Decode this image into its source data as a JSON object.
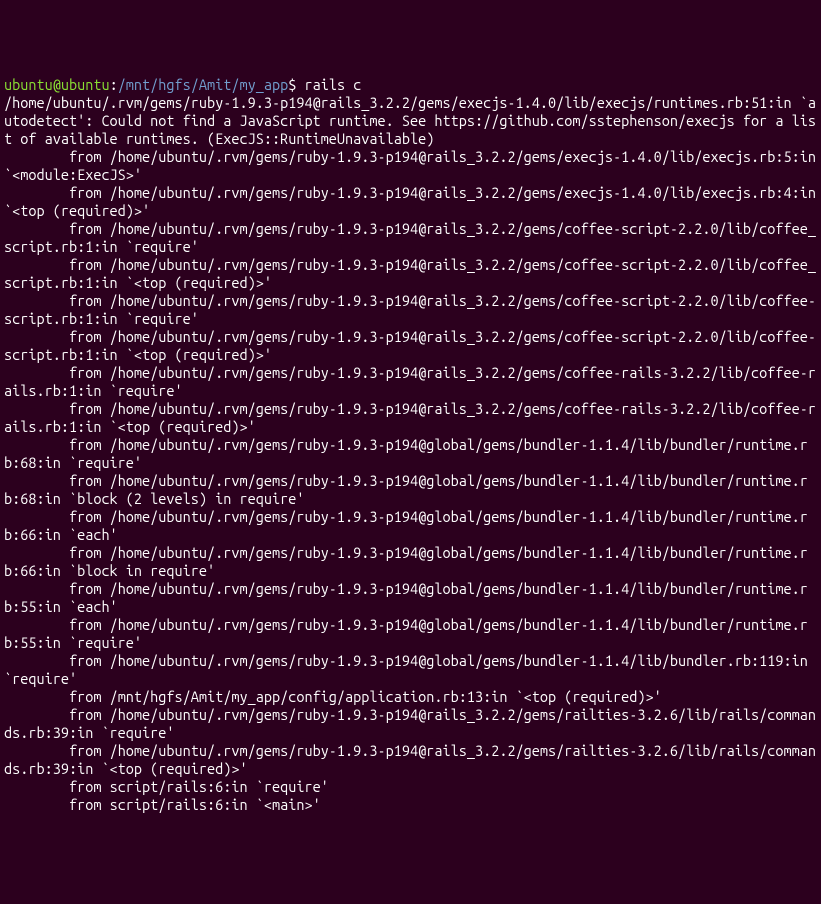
{
  "prompt": {
    "user_host": "ubuntu@ubuntu",
    "separator": ":",
    "path": "/mnt/hgfs/Amit/my_app",
    "symbol": "$",
    "command": "rails c"
  },
  "lines": [
    "/home/ubuntu/.rvm/gems/ruby-1.9.3-p194@rails_3.2.2/gems/execjs-1.4.0/lib/execjs/runtimes.rb:51:in `autodetect': Could not find a JavaScript runtime. See https://github.com/sstephenson/execjs for a list of available runtimes. (ExecJS::RuntimeUnavailable)",
    "        from /home/ubuntu/.rvm/gems/ruby-1.9.3-p194@rails_3.2.2/gems/execjs-1.4.0/lib/execjs.rb:5:in `<module:ExecJS>'",
    "        from /home/ubuntu/.rvm/gems/ruby-1.9.3-p194@rails_3.2.2/gems/execjs-1.4.0/lib/execjs.rb:4:in `<top (required)>'",
    "        from /home/ubuntu/.rvm/gems/ruby-1.9.3-p194@rails_3.2.2/gems/coffee-script-2.2.0/lib/coffee_script.rb:1:in `require'",
    "        from /home/ubuntu/.rvm/gems/ruby-1.9.3-p194@rails_3.2.2/gems/coffee-script-2.2.0/lib/coffee_script.rb:1:in `<top (required)>'",
    "        from /home/ubuntu/.rvm/gems/ruby-1.9.3-p194@rails_3.2.2/gems/coffee-script-2.2.0/lib/coffee-script.rb:1:in `require'",
    "        from /home/ubuntu/.rvm/gems/ruby-1.9.3-p194@rails_3.2.2/gems/coffee-script-2.2.0/lib/coffee-script.rb:1:in `<top (required)>'",
    "        from /home/ubuntu/.rvm/gems/ruby-1.9.3-p194@rails_3.2.2/gems/coffee-rails-3.2.2/lib/coffee-rails.rb:1:in `require'",
    "        from /home/ubuntu/.rvm/gems/ruby-1.9.3-p194@rails_3.2.2/gems/coffee-rails-3.2.2/lib/coffee-rails.rb:1:in `<top (required)>'",
    "        from /home/ubuntu/.rvm/gems/ruby-1.9.3-p194@global/gems/bundler-1.1.4/lib/bundler/runtime.rb:68:in `require'",
    "        from /home/ubuntu/.rvm/gems/ruby-1.9.3-p194@global/gems/bundler-1.1.4/lib/bundler/runtime.rb:68:in `block (2 levels) in require'",
    "        from /home/ubuntu/.rvm/gems/ruby-1.9.3-p194@global/gems/bundler-1.1.4/lib/bundler/runtime.rb:66:in `each'",
    "        from /home/ubuntu/.rvm/gems/ruby-1.9.3-p194@global/gems/bundler-1.1.4/lib/bundler/runtime.rb:66:in `block in require'",
    "        from /home/ubuntu/.rvm/gems/ruby-1.9.3-p194@global/gems/bundler-1.1.4/lib/bundler/runtime.rb:55:in `each'",
    "        from /home/ubuntu/.rvm/gems/ruby-1.9.3-p194@global/gems/bundler-1.1.4/lib/bundler/runtime.rb:55:in `require'",
    "        from /home/ubuntu/.rvm/gems/ruby-1.9.3-p194@global/gems/bundler-1.1.4/lib/bundler.rb:119:in `require'",
    "        from /mnt/hgfs/Amit/my_app/config/application.rb:13:in `<top (required)>'",
    "        from /home/ubuntu/.rvm/gems/ruby-1.9.3-p194@rails_3.2.2/gems/railties-3.2.6/lib/rails/commands.rb:39:in `require'",
    "        from /home/ubuntu/.rvm/gems/ruby-1.9.3-p194@rails_3.2.2/gems/railties-3.2.6/lib/rails/commands.rb:39:in `<top (required)>'",
    "        from script/rails:6:in `require'",
    "        from script/rails:6:in `<main>'"
  ]
}
